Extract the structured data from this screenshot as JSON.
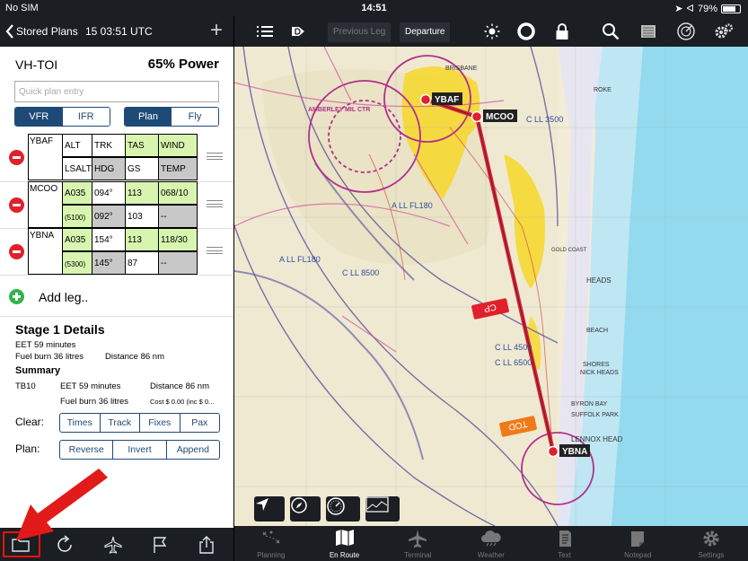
{
  "status": {
    "carrier": "No SIM",
    "time": "14:51",
    "battery": "79%",
    "battery_level": 0.79
  },
  "left_header": {
    "back_label": "Stored Plans",
    "time": "15 03:51 UTC"
  },
  "plan": {
    "registration": "VH-TOI",
    "power": "65% Power",
    "quick_entry_placeholder": "Quick plan entry",
    "rules": [
      "VFR",
      "IFR"
    ],
    "rules_selected": "VFR",
    "mode": [
      "Plan",
      "Fly"
    ],
    "mode_selected": "Plan",
    "legs": [
      {
        "waypoint": "YBAF",
        "row1": [
          "ALT",
          "TRK",
          "TAS",
          "WIND"
        ],
        "row2": [
          "LSALT",
          "HDG",
          "GS",
          "TEMP"
        ]
      },
      {
        "waypoint": "MCOO",
        "row1": [
          "A035",
          "094°",
          "113",
          "068/10"
        ],
        "row2": [
          "(5100)",
          "092°",
          "103",
          "--"
        ]
      },
      {
        "waypoint": "YBNA",
        "row1": [
          "A035",
          "154°",
          "113",
          "118/30"
        ],
        "row2": [
          "(5300)",
          "145°",
          "87",
          "--"
        ]
      }
    ],
    "add_leg": "Add leg..",
    "stage_title": "Stage 1 Details",
    "stage_eet": "EET 59 minutes",
    "stage_fuel": "Fuel burn 36 litres",
    "stage_distance": "Distance 86 nm",
    "summary_title": "Summary",
    "summary_aircraft": "TB10",
    "summary_eet": "EET 59 minutes",
    "summary_distance": "Distance 86 nm",
    "summary_fuel": "Fuel burn 36 litres",
    "summary_cost": "Cost $ 0.00 (inc $ 0...",
    "clear_label": "Clear:",
    "clear_buttons": [
      "Times",
      "Track",
      "Fixes",
      "Pax"
    ],
    "plan_label": "Plan:",
    "plan_buttons": [
      "Reverse",
      "Invert",
      "Append"
    ]
  },
  "toolbar": {
    "previous_leg": "Previous Leg",
    "departure": "Departure"
  },
  "map": {
    "waypoints": [
      "YBAF",
      "MCOO",
      "YBNA"
    ],
    "labels": {
      "brisbane": "BRISBANE",
      "amberley": "AMBERLEY MIL CTR",
      "cp": "CP",
      "tod": "TOD",
      "l3500": "C LL 3500",
      "fl180a": "A LL FL180",
      "fl180b": "A LL FL180",
      "l8500": "C LL 8500",
      "l4500": "C LL 4500",
      "l6500": "C LL 6500",
      "heads": "HEADS",
      "gold": "GOLD COAST",
      "byron": "BYRON BAY",
      "suffolk": "SUFFOLK PARK",
      "lennox": "LENNOX HEAD",
      "beach": "BEACH",
      "roke": "ROKE",
      "shores": "SHORES",
      "nocp": "NICK HEADS"
    }
  },
  "tabs": [
    {
      "label": "Planning",
      "active": false
    },
    {
      "label": "En Route",
      "active": true
    },
    {
      "label": "Terminal",
      "active": false
    },
    {
      "label": "Weather",
      "active": false
    },
    {
      "label": "Text",
      "active": false
    },
    {
      "label": "Notepad",
      "active": false
    },
    {
      "label": "Settings",
      "active": false
    }
  ],
  "colors": {
    "bar": "#1b1e22",
    "accent": "#1e4a77",
    "route": "#d0283a",
    "remove": "#e0202a",
    "add": "#35b34a",
    "arrow": "#e11a1a"
  }
}
